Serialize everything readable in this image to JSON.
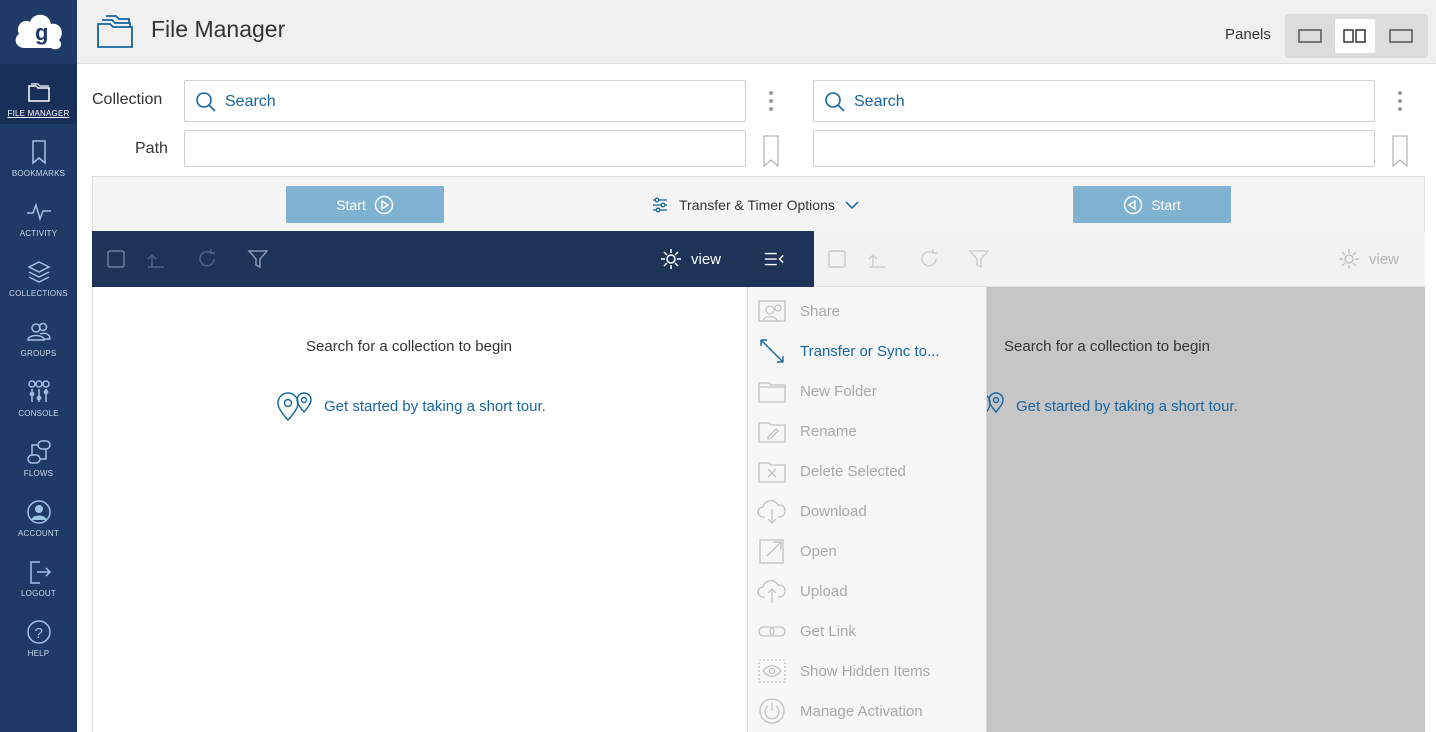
{
  "sidebar": {
    "logo_icon": "globus-cloud-logo",
    "items": [
      {
        "label": "FILE MANAGER",
        "icon": "folder-icon",
        "active": true
      },
      {
        "label": "BOOKMARKS",
        "icon": "bookmark-icon"
      },
      {
        "label": "ACTIVITY",
        "icon": "pulse-icon"
      },
      {
        "label": "COLLECTIONS",
        "icon": "layers-icon"
      },
      {
        "label": "GROUPS",
        "icon": "people-icon"
      },
      {
        "label": "CONSOLE",
        "icon": "sliders-icon"
      },
      {
        "label": "FLOWS",
        "icon": "flows-icon"
      },
      {
        "label": "ACCOUNT",
        "icon": "user-icon"
      },
      {
        "label": "LOGOUT",
        "icon": "logout-icon"
      },
      {
        "label": "HELP",
        "icon": "help-icon"
      }
    ]
  },
  "header": {
    "title": "File Manager",
    "panels_label": "Panels",
    "panel_options": [
      "single-panel-icon",
      "dual-panel-icon",
      "right-panel-icon"
    ],
    "active_panel": "dual-panel-icon"
  },
  "fields": {
    "collection_label": "Collection",
    "path_label": "Path",
    "left_search_placeholder": "Search",
    "right_search_placeholder": "Search",
    "left_path_value": "",
    "right_path_value": ""
  },
  "transfer": {
    "start_left": "Start",
    "start_right": "Start",
    "options": "Transfer & Timer Options"
  },
  "toolbar": {
    "view_left": "view",
    "view_right": "view"
  },
  "panes": {
    "left_empty": "Search for a collection to begin",
    "left_tour": "Get started by taking a short tour.",
    "right_empty": "Search for a collection to begin",
    "right_tour": "Get started by taking a short tour."
  },
  "menu": {
    "items": [
      {
        "label": "Share",
        "icon": "share-icon",
        "enabled": false
      },
      {
        "label": "Transfer or Sync to...",
        "icon": "transfer-arrow-icon",
        "enabled": true
      },
      {
        "label": "New Folder",
        "icon": "new-folder-icon",
        "enabled": false
      },
      {
        "label": "Rename",
        "icon": "rename-icon",
        "enabled": false
      },
      {
        "label": "Delete Selected",
        "icon": "delete-icon",
        "enabled": false
      },
      {
        "label": "Download",
        "icon": "download-icon",
        "enabled": false
      },
      {
        "label": "Open",
        "icon": "open-icon",
        "enabled": false
      },
      {
        "label": "Upload",
        "icon": "upload-icon",
        "enabled": false
      },
      {
        "label": "Get Link",
        "icon": "link-icon",
        "enabled": false
      },
      {
        "label": "Show Hidden Items",
        "icon": "eye-icon",
        "enabled": false
      },
      {
        "label": "Manage Activation",
        "icon": "power-icon",
        "enabled": false
      }
    ]
  },
  "colors": {
    "sidebar": "#1f3a66",
    "toolbar_dark": "#1e3358",
    "start_button": "#7fb3d1",
    "link": "#1565a0",
    "disabled_text": "#a8a8a8",
    "right_pane_overlay": "#c6c6c6"
  }
}
